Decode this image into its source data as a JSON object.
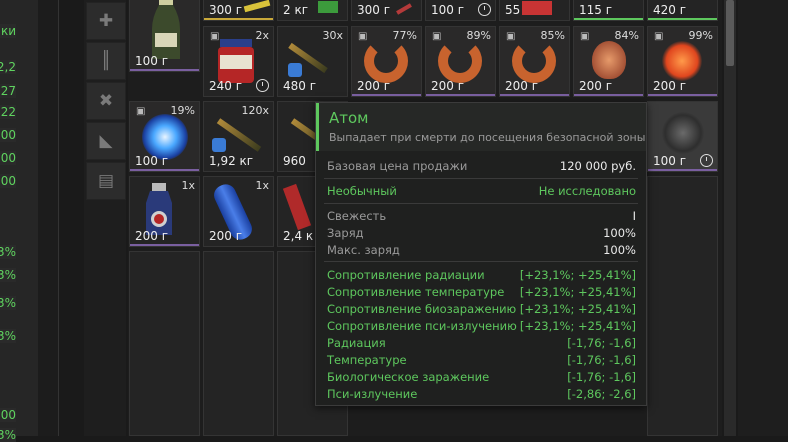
{
  "left_panel": {
    "fragment": "ки",
    "values": [
      "2,2",
      "27",
      "22",
      "00",
      "00",
      "00",
      "3%",
      "3%",
      "3%",
      "3%",
      "00",
      "3%"
    ]
  },
  "grid": {
    "cells": [
      {
        "price": "100 г",
        "count": "",
        "locked": false,
        "clock": false,
        "icon": "champagne-bottle-icon"
      },
      {
        "price": "300 г",
        "count": "",
        "locked": false,
        "clock": false,
        "icon": "knife-icon"
      },
      {
        "price": "2 кг",
        "count": "",
        "locked": false,
        "clock": false,
        "icon": "green-box-icon"
      },
      {
        "price": "300 г",
        "count": "",
        "locked": false,
        "clock": false,
        "icon": "ammo-icon"
      },
      {
        "price": "100 г",
        "count": "",
        "locked": false,
        "clock": true,
        "icon": "item-icon"
      },
      {
        "price": "55",
        "count": "",
        "locked": false,
        "clock": false,
        "icon": "red-pack-icon"
      },
      {
        "price": "115 г",
        "count": "",
        "locked": false,
        "clock": false,
        "icon": "item-icon"
      },
      {
        "price": "420 г",
        "count": "",
        "locked": false,
        "clock": false,
        "icon": "item-icon"
      },
      {
        "price": "240 г",
        "count": "2x",
        "locked": true,
        "clock": true,
        "icon": "atlas-jar-icon"
      },
      {
        "price": "480 г",
        "count": "30x",
        "locked": false,
        "clock": false,
        "icon": "cartridge-icon"
      },
      {
        "price": "200 г",
        "count": "77%",
        "locked": true,
        "clock": false,
        "icon": "shrimp-artifact-icon"
      },
      {
        "price": "200 г",
        "count": "89%",
        "locked": true,
        "clock": false,
        "icon": "shrimp-artifact-icon"
      },
      {
        "price": "200 г",
        "count": "85%",
        "locked": true,
        "clock": false,
        "icon": "shrimp-artifact-icon"
      },
      {
        "price": "200 г",
        "count": "84%",
        "locked": true,
        "clock": false,
        "icon": "shell-artifact-icon"
      },
      {
        "price": "200 г",
        "count": "99%",
        "locked": true,
        "clock": false,
        "icon": "fire-orb-icon"
      },
      {
        "price": "100 г",
        "count": "19%",
        "locked": true,
        "clock": false,
        "icon": "electric-orb-icon"
      },
      {
        "price": "1,92 кг",
        "count": "120x",
        "locked": false,
        "clock": false,
        "icon": "cartridge-icon"
      },
      {
        "price": "960",
        "count": "",
        "locked": false,
        "clock": false,
        "icon": "cartridge-icon"
      },
      {
        "price": "100 г",
        "count": "",
        "locked": false,
        "clock": true,
        "icon": "atom-artifact-icon"
      },
      {
        "price": "200 г",
        "count": "1x",
        "locked": false,
        "clock": false,
        "icon": "blue-bottle-icon"
      },
      {
        "price": "200 г",
        "count": "1x",
        "locked": false,
        "clock": false,
        "icon": "blue-capsule-icon"
      },
      {
        "price": "2,4 к",
        "count": "",
        "locked": false,
        "clock": false,
        "icon": "red-pipe-icon"
      }
    ]
  },
  "tooltip": {
    "title": "Атом",
    "description": "Выпадает при смерти до посещения безопасной зоны",
    "base_price_label": "Базовая цена продажи",
    "base_price_value": "120 000 руб.",
    "rarity_label": "Необычный",
    "research_status": "Не исследовано",
    "stats": [
      {
        "label": "Свежесть",
        "value": "I"
      },
      {
        "label": "Заряд",
        "value": "100%"
      },
      {
        "label": "Макс. заряд",
        "value": "100%"
      }
    ],
    "bonuses": [
      {
        "label": "Сопротивление радиации",
        "value": "[+23,1%; +25,41%]"
      },
      {
        "label": "Сопротивление температуре",
        "value": "[+23,1%; +25,41%]"
      },
      {
        "label": "Сопротивление биозаражению",
        "value": "[+23,1%; +25,41%]"
      },
      {
        "label": "Сопротивление пси-излучению",
        "value": "[+23,1%; +25,41%]"
      }
    ],
    "penalties": [
      {
        "label": "Радиация",
        "value": "[-1,76; -1,6]"
      },
      {
        "label": "Температуре",
        "value": "[-1,76; -1,6]"
      },
      {
        "label": "Биологическое заражение",
        "value": "[-1,76; -1,6]"
      },
      {
        "label": "Пси-излучение",
        "value": "[-2,86; -2,6]"
      }
    ]
  },
  "colors": {
    "accent_green": "#5ec85e",
    "background": "#1a1a1a"
  }
}
